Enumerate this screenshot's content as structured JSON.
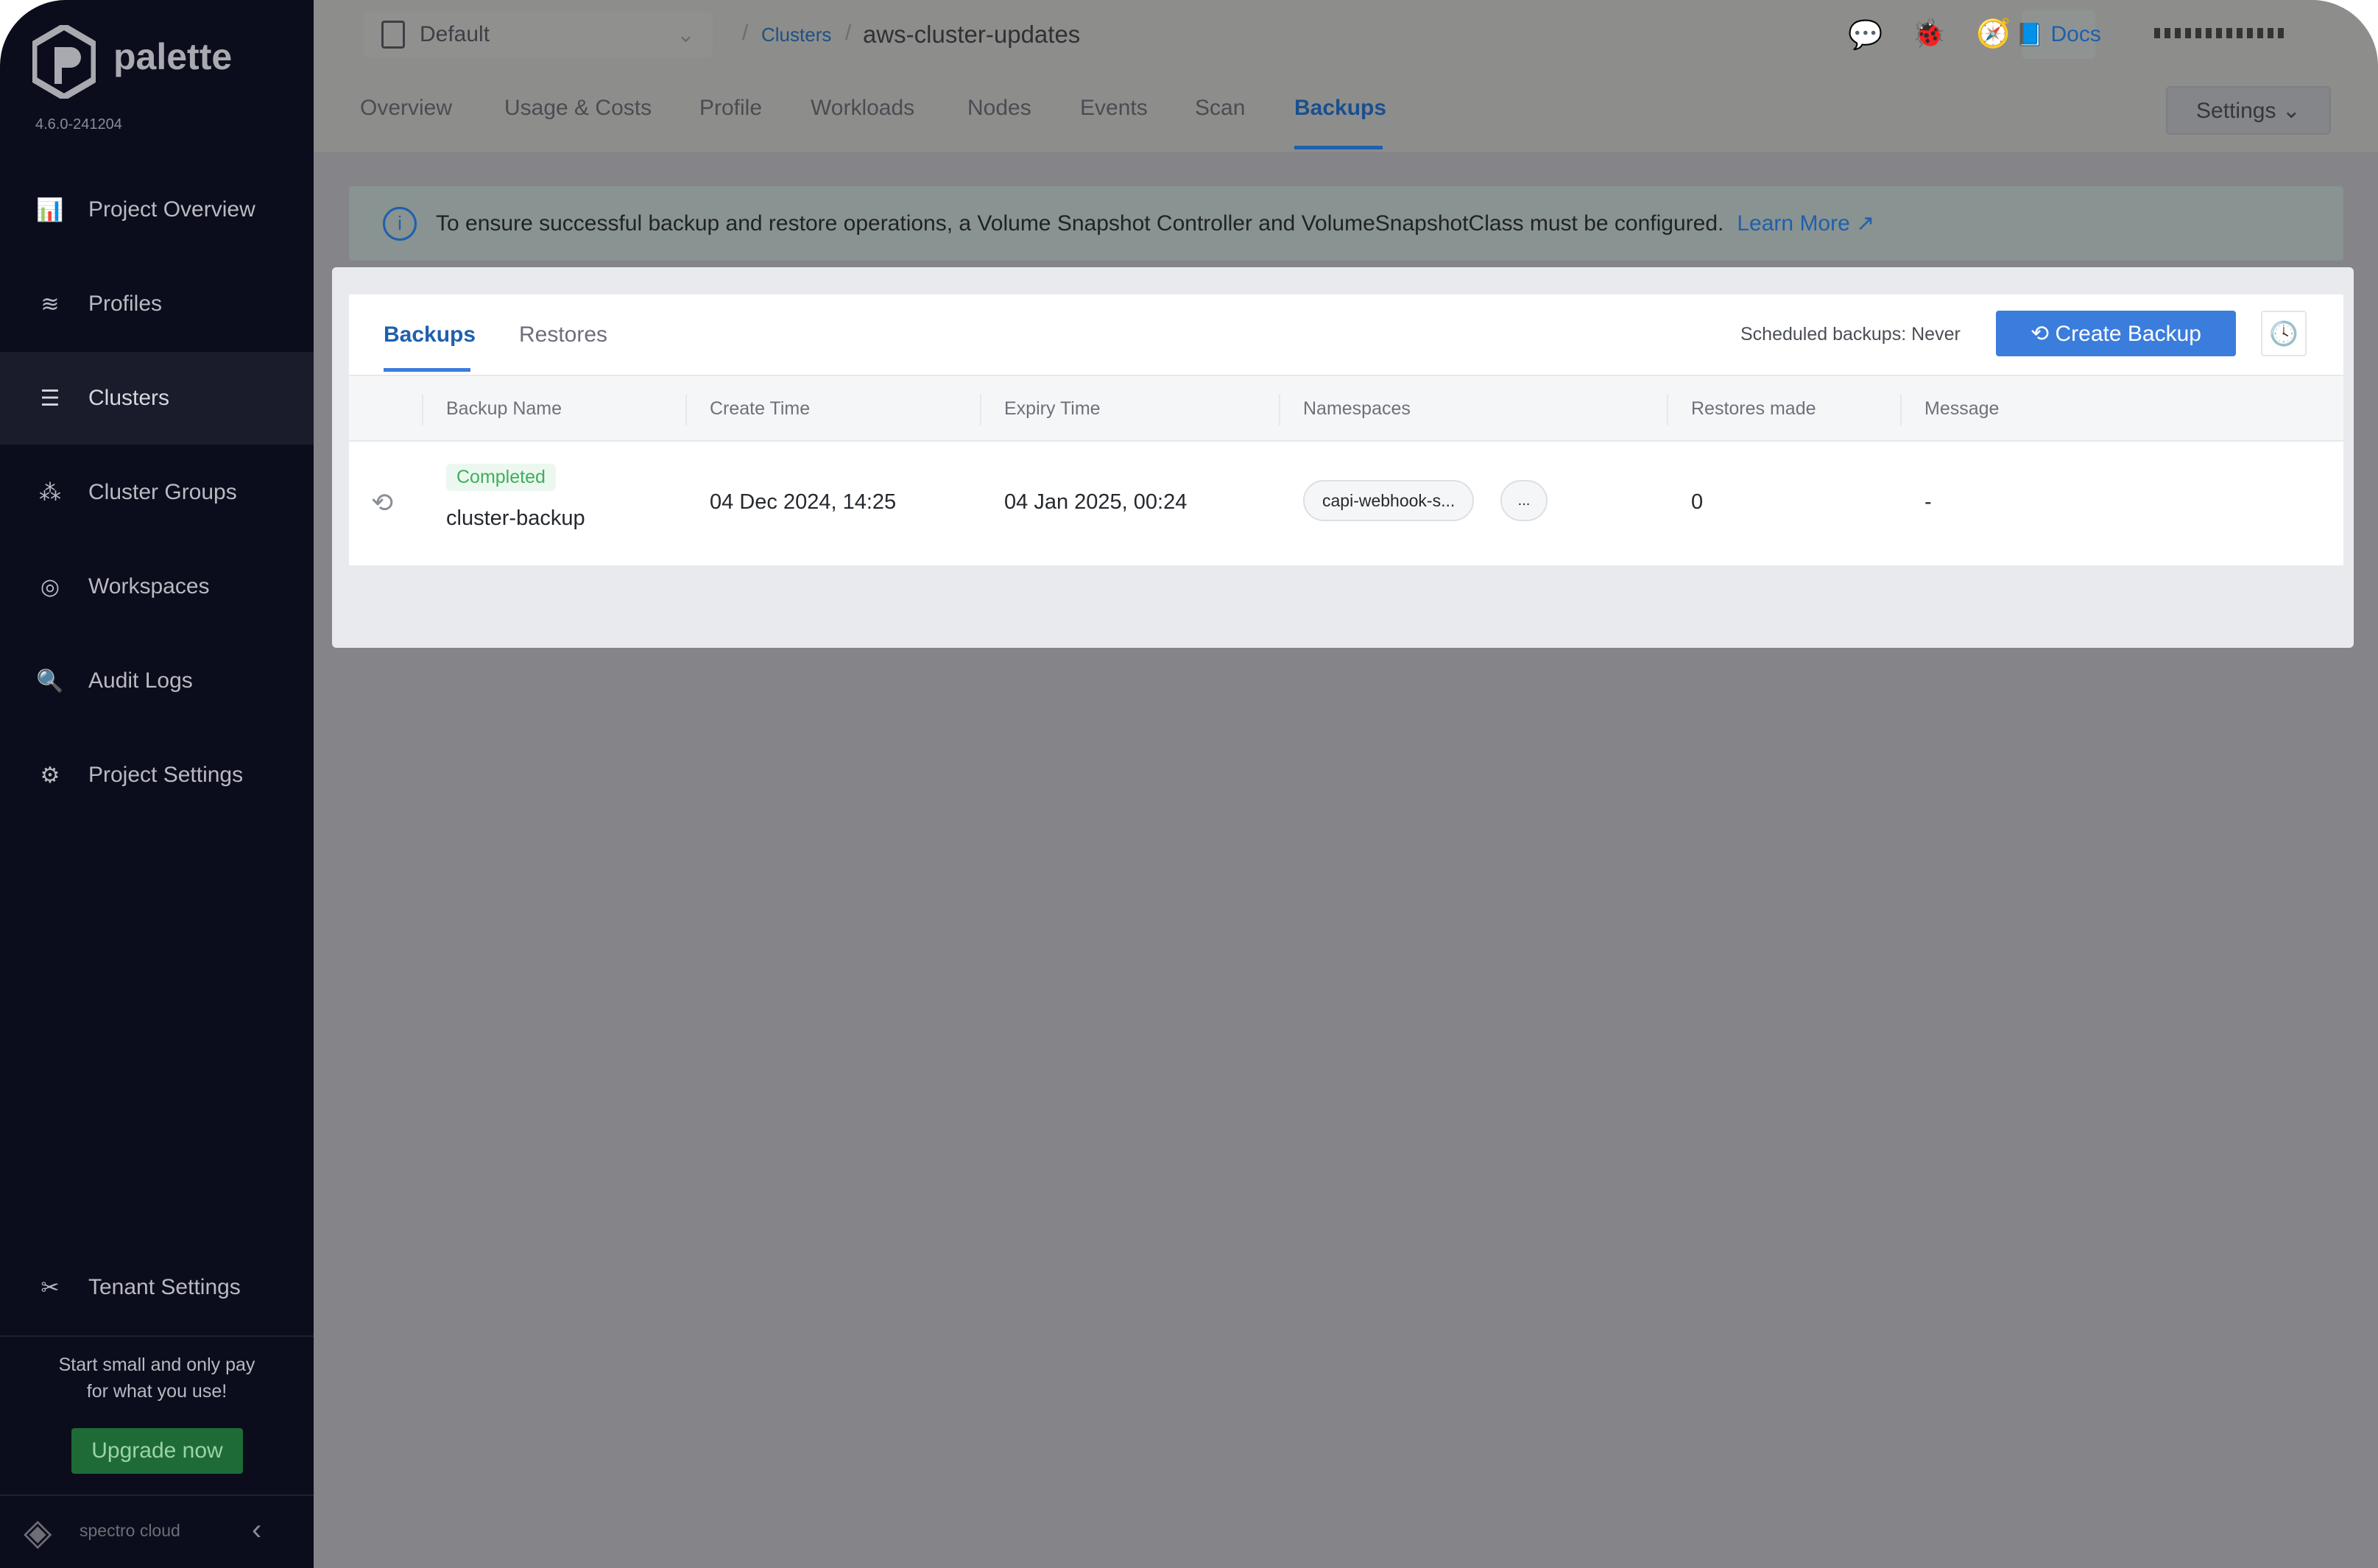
{
  "sidebar": {
    "brand": "palette",
    "version": "4.6.0-241204",
    "items": [
      {
        "label": "Project Overview",
        "icon": "chart-icon"
      },
      {
        "label": "Profiles",
        "icon": "database-icon"
      },
      {
        "label": "Clusters",
        "icon": "clusters-icon",
        "active": true
      },
      {
        "label": "Cluster Groups",
        "icon": "cluster-groups-icon"
      },
      {
        "label": "Workspaces",
        "icon": "workspaces-icon"
      },
      {
        "label": "Audit Logs",
        "icon": "audit-logs-icon"
      },
      {
        "label": "Project Settings",
        "icon": "gear-icon"
      }
    ],
    "tenant_settings": "Tenant Settings",
    "promo_line1": "Start small and only pay",
    "promo_line2": "for what you use!",
    "upgrade": "Upgrade now",
    "footer_brand": "spectro cloud"
  },
  "header": {
    "project": "Default",
    "breadcrumb_link": "Clusters",
    "breadcrumb_current": "aws-cluster-updates",
    "docs": "Docs",
    "tabs": [
      "Overview",
      "Usage & Costs",
      "Profile",
      "Workloads",
      "Nodes",
      "Events",
      "Scan",
      "Backups"
    ],
    "active_tab": "Backups",
    "settings": "Settings"
  },
  "banner": {
    "text": "To ensure successful backup and restore operations, a Volume Snapshot Controller and VolumeSnapshotClass must be configured.",
    "link": "Learn More"
  },
  "backups": {
    "tabs": [
      "Backups",
      "Restores"
    ],
    "scheduled": "Scheduled backups: Never",
    "create": "Create Backup",
    "columns": [
      "Backup Name",
      "Create Time",
      "Expiry Time",
      "Namespaces",
      "Restores made",
      "Message"
    ],
    "rows": [
      {
        "status": "Completed",
        "name": "cluster-backup",
        "create_time": "04 Dec 2024, 14:25",
        "expiry_time": "04 Jan 2025, 00:24",
        "namespace": "capi-webhook-s...",
        "more": "...",
        "restores": "0",
        "message": "-"
      }
    ]
  },
  "colors": {
    "accent": "#3b7ddd",
    "sidebar": "#0b0c1c",
    "success": "#3fae5c"
  }
}
